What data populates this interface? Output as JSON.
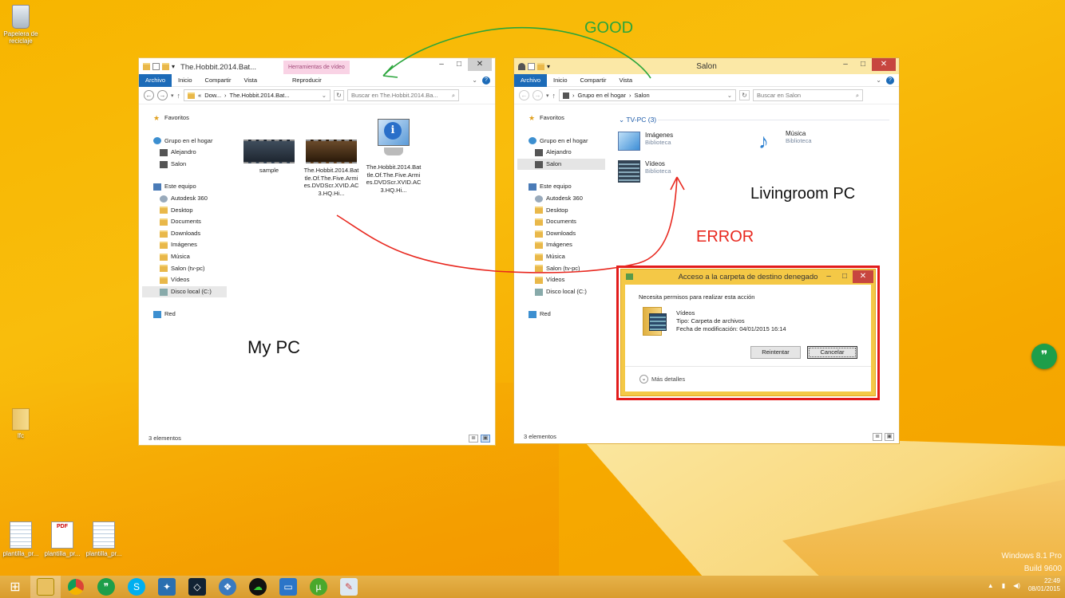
{
  "desktop": {
    "icons": [
      {
        "label": "Papelera de reciclaje",
        "icon": "recycle-bin-icon"
      },
      {
        "label": "lfc",
        "icon": "folder-icon"
      },
      {
        "label": "plantilla_pr...",
        "icon": "spreadsheet-icon"
      },
      {
        "label": "plantilla_pr...",
        "icon": "pdf-icon"
      },
      {
        "label": "plantilla_pr...",
        "icon": "spreadsheet-icon"
      }
    ],
    "watermark": {
      "line1": "Windows 8.1 Pro",
      "line2": "Build 9600"
    }
  },
  "annotations": {
    "good": "GOOD",
    "error": "ERROR",
    "my_pc": "My PC",
    "livingroom": "Livingroom PC",
    "colors": {
      "good": "#2aa53b",
      "error": "#e8281f"
    }
  },
  "left_window": {
    "title": "The.Hobbit.2014.Bat...",
    "context_tab": "Herramientas de vídeo",
    "ribbon": [
      "Archivo",
      "Inicio",
      "Compartir",
      "Vista",
      "Reproducir"
    ],
    "address": {
      "parts": [
        "«",
        "Dow...",
        "›",
        "The.Hobbit.2014.Bat..."
      ]
    },
    "search_placeholder": "Buscar en The.Hobbit.2014.Ba...",
    "nav": [
      {
        "label": "Favoritos",
        "icon": "star-icon"
      },
      {
        "label": "Grupo en el hogar",
        "icon": "homegroup-icon"
      },
      {
        "label": "Alejandro",
        "icon": "user-icon"
      },
      {
        "label": "Salon",
        "icon": "user-icon"
      },
      {
        "label": "Este equipo",
        "icon": "computer-icon"
      },
      {
        "label": "Autodesk 360",
        "icon": "cloud-icon"
      },
      {
        "label": "Desktop",
        "icon": "folder-icon"
      },
      {
        "label": "Documents",
        "icon": "folder-icon"
      },
      {
        "label": "Downloads",
        "icon": "folder-icon"
      },
      {
        "label": "Imágenes",
        "icon": "folder-icon"
      },
      {
        "label": "Música",
        "icon": "folder-icon"
      },
      {
        "label": "Salon (tv-pc)",
        "icon": "folder-icon"
      },
      {
        "label": "Vídeos",
        "icon": "folder-icon"
      },
      {
        "label": "Disco local (C:)",
        "icon": "drive-icon"
      },
      {
        "label": "Red",
        "icon": "network-icon"
      }
    ],
    "files": [
      {
        "name": "sample",
        "icon": "video-thumbnail-icon"
      },
      {
        "name": "The.Hobbit.2014.Battle.Of.The.Five.Armies.DVDScr.XVID.AC3.HQ.Hi...",
        "icon": "video-thumbnail-icon"
      },
      {
        "name": "The.Hobbit.2014.Battle.Of.The.Five.Armies.DVDScr.XVID.AC3.HQ.Hi...",
        "icon": "info-file-icon"
      }
    ],
    "status": "3 elementos"
  },
  "right_window": {
    "title": "Salon",
    "ribbon": [
      "Archivo",
      "Inicio",
      "Compartir",
      "Vista"
    ],
    "address": {
      "parts": [
        "›",
        "Grupo en el hogar",
        "›",
        "Salon"
      ]
    },
    "search_placeholder": "Buscar en Salon",
    "nav": [
      {
        "label": "Favoritos",
        "icon": "star-icon"
      },
      {
        "label": "Grupo en el hogar",
        "icon": "homegroup-icon"
      },
      {
        "label": "Alejandro",
        "icon": "user-icon"
      },
      {
        "label": "Salon",
        "icon": "user-icon"
      },
      {
        "label": "Este equipo",
        "icon": "computer-icon"
      },
      {
        "label": "Autodesk 360",
        "icon": "cloud-icon"
      },
      {
        "label": "Desktop",
        "icon": "folder-icon"
      },
      {
        "label": "Documents",
        "icon": "folder-icon"
      },
      {
        "label": "Downloads",
        "icon": "folder-icon"
      },
      {
        "label": "Imágenes",
        "icon": "folder-icon"
      },
      {
        "label": "Música",
        "icon": "folder-icon"
      },
      {
        "label": "Salon (tv-pc)",
        "icon": "folder-icon"
      },
      {
        "label": "Vídeos",
        "icon": "folder-icon"
      },
      {
        "label": "Disco local (C:)",
        "icon": "drive-icon"
      },
      {
        "label": "Red",
        "icon": "network-icon"
      }
    ],
    "group_header": "TV-PC (3)",
    "libraries": [
      {
        "name": "Imágenes",
        "sub": "Biblioteca",
        "icon": "pictures-library-icon"
      },
      {
        "name": "Música",
        "sub": "Biblioteca",
        "icon": "music-library-icon"
      },
      {
        "name": "Vídeos",
        "sub": "Biblioteca",
        "icon": "videos-library-icon"
      }
    ],
    "status": "3 elementos"
  },
  "dialog": {
    "title": "Acceso a la carpeta de destino denegado",
    "message": "Necesita permisos para realizar esta acción",
    "item_name": "Vídeos",
    "item_type": "Tipo: Carpeta de archivos",
    "item_date": "Fecha de modificación: 04/01/2015 16:14",
    "retry": "Reintentar",
    "cancel": "Cancelar",
    "more": "Más detalles"
  },
  "taskbar": {
    "apps": [
      "start-icon",
      "file-explorer-icon",
      "chrome-icon",
      "hangouts-icon",
      "skype-icon",
      "app-icon",
      "autodesk-icon",
      "app-icon",
      "cloud-app-icon",
      "remote-desktop-icon",
      "utorrent-icon",
      "paint-icon"
    ],
    "time": "22:49",
    "date": "08/01/2015"
  }
}
